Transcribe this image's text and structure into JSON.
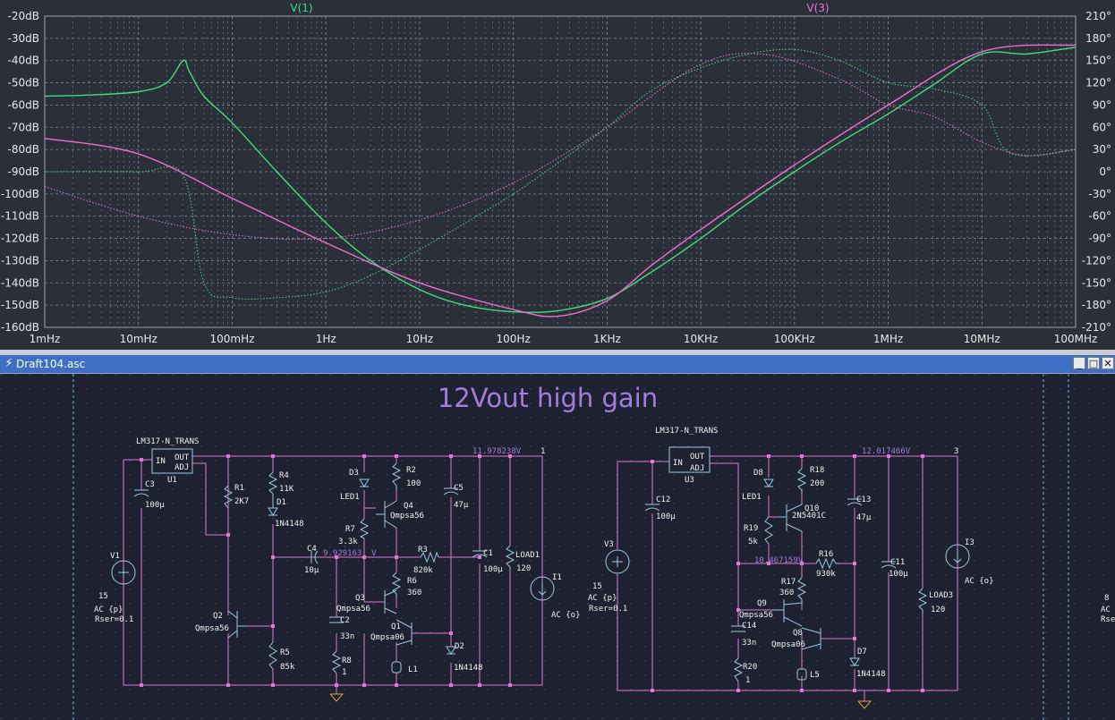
{
  "plot": {
    "trace1_label": "V(1)",
    "trace2_label": "V(3)",
    "colors": {
      "trace1": "#3fe07a",
      "trace2": "#ee6fce",
      "axis_text": "#e8e8e8",
      "grid": "#7d8496",
      "background": "#2b2f3a"
    },
    "y_left_ticks": [
      "-20dB",
      "-30dB",
      "-40dB",
      "-50dB",
      "-60dB",
      "-70dB",
      "-80dB",
      "-90dB",
      "-100dB",
      "-110dB",
      "-120dB",
      "-130dB",
      "-140dB",
      "-150dB",
      "-160dB"
    ],
    "y_right_ticks": [
      "210°",
      "180°",
      "150°",
      "120°",
      "90°",
      "60°",
      "30°",
      "0°",
      "-30°",
      "-60°",
      "-90°",
      "-120°",
      "-150°",
      "-180°",
      "-210°"
    ],
    "x_ticks": [
      "1mHz",
      "10mHz",
      "100mHz",
      "1Hz",
      "10Hz",
      "100Hz",
      "1KHz",
      "10KHz",
      "100KHz",
      "1MHz",
      "10MHz",
      "100MHz"
    ]
  },
  "chart_data": {
    "type": "line",
    "x_scale": "log",
    "xlim": [
      0.001,
      100000000
    ],
    "ylim_left": [
      -160,
      -20
    ],
    "ylim_right": [
      -210,
      210
    ],
    "xlabel": "",
    "ylabel": "",
    "series": [
      {
        "name": "V(1)",
        "axis": "magnitude dB",
        "x": [
          0.001,
          0.003,
          0.01,
          0.02,
          0.03,
          0.035,
          0.05,
          0.1,
          0.3,
          1,
          3,
          10,
          30,
          100,
          300,
          1000,
          3000,
          10000,
          30000,
          100000,
          300000,
          1000000,
          3000000,
          10000000,
          30000000,
          100000000
        ],
        "y": [
          -56,
          -55.5,
          -54,
          -50,
          -40,
          -45,
          -56,
          -68,
          -90,
          -113,
          -130,
          -143,
          -150,
          -153,
          -152.5,
          -147,
          -135,
          -120,
          -105,
          -90,
          -77,
          -64,
          -51,
          -37,
          -37,
          -34
        ]
      },
      {
        "name": "V(1)",
        "axis": "phase deg",
        "x": [
          0.001,
          0.01,
          0.03,
          0.05,
          0.1,
          0.3,
          1,
          3,
          10,
          30,
          100,
          300,
          1000,
          3000,
          10000,
          30000,
          100000,
          300000,
          1000000,
          3000000,
          10000000,
          20000000,
          100000000
        ],
        "y": [
          0,
          0,
          -5,
          -150,
          -170,
          -170,
          -162,
          -140,
          -105,
          -70,
          -30,
          12,
          60,
          110,
          140,
          158,
          165,
          150,
          120,
          112,
          90,
          25,
          30
        ]
      },
      {
        "name": "V(3)",
        "axis": "magnitude dB",
        "x": [
          0.001,
          0.01,
          0.1,
          1,
          10,
          100,
          300,
          1000,
          3000,
          10000,
          100000,
          1000000,
          10000000,
          100000000
        ],
        "y": [
          -75,
          -82,
          -102,
          -122,
          -140,
          -152,
          -155,
          -148,
          -132,
          -116,
          -87,
          -60,
          -36,
          -33
        ]
      },
      {
        "name": "V(3)",
        "axis": "phase deg",
        "x": [
          0.001,
          0.01,
          0.1,
          1,
          10,
          100,
          1000,
          10000,
          50000,
          300000,
          1000000,
          3000000,
          10000000,
          30000000,
          100000000
        ],
        "y": [
          -20,
          -60,
          -85,
          -90,
          -65,
          -15,
          60,
          145,
          158,
          125,
          90,
          75,
          40,
          22,
          30
        ]
      }
    ]
  },
  "window": {
    "title": "Draft104.asc",
    "app_icon": "ltspice-icon",
    "minimize": "_",
    "restore": "□",
    "close": "✕"
  },
  "schematic": {
    "heading": "12Vout high gain",
    "colors": {
      "wire": "#e078d8",
      "component": "#9cc8e0",
      "text": "#f0f0f0",
      "net_label": "#a37ce0",
      "junction": "#e078d8",
      "ground": "#e0a040"
    },
    "left": {
      "ic_name": "LM317-N_TRANS",
      "ic_ref": "U1",
      "ic_in": "IN",
      "ic_out": "OUT",
      "ic_adj": "ADJ",
      "out_voltage": "11.978238V",
      "out_node": "1",
      "mid_voltage": "9.929163  V",
      "V1": "V1",
      "V1_val": "15",
      "V1_ac": "AC {p}",
      "V1_rser": "Rser=0.1",
      "C3": "C3",
      "C3_val": "100µ",
      "R1": "R1",
      "R1_val": "2K7",
      "R4": "R4",
      "R4_val": "11K",
      "D1": "D1",
      "D1_val": "1N4148",
      "D3": "D3",
      "D3_val": "LED1",
      "R2": "R2",
      "R2_val": "100",
      "Q4": "Q4",
      "Q4_val": "Qmpsa56",
      "C5": "C5",
      "C5_val": "47µ",
      "R7": "R7",
      "R7_val": "3.3k",
      "C4": "C4",
      "C4_val": "10µ",
      "R3": "R3",
      "R3_val": "820k",
      "R6": "R6",
      "R6_val": "360",
      "C1": "C1",
      "C1_val": "100µ",
      "LOAD1": "LOAD1",
      "LOAD1_val": "120",
      "I1": "I1",
      "I1_val": "AC {o}",
      "Q2": "Q2",
      "Q2_val": "Qmpsa56",
      "Q3": "Q3",
      "Q3_val": "Qmpsa56",
      "C2": "C2",
      "C2_val": "33n",
      "Q1": "Q1",
      "Q1_val": "Qmpsa06",
      "D2": "D2",
      "D2_val": "1N4148",
      "R5": "R5",
      "R5_val": "85k",
      "R8": "R8",
      "R8_val": "1",
      "L1": "L1"
    },
    "right": {
      "ic_name": "LM317-N_TRANS",
      "ic_ref": "U3",
      "ic_in": "IN",
      "ic_out": "OUT",
      "ic_adj": "ADJ",
      "out_voltage": "12.017466V",
      "out_node": "3",
      "mid_voltage": "10.467159V",
      "V3": "V3",
      "V3_val": "15",
      "V3_ac": "AC {p}",
      "V3_rser": "Rser=0.1",
      "C12": "C12",
      "C12_val": "100µ",
      "D8": "D8",
      "D8_val": "LED1",
      "R18": "R18",
      "R18_val": "200",
      "Q10": "Q10",
      "Q10_val": "2N5401C",
      "C13": "C13",
      "C13_val": "47µ",
      "R19": "R19",
      "R19_val": "5k",
      "R16": "R16",
      "R16_val": "930k",
      "C11": "C11",
      "C11_val": "100µ",
      "I3": "I3",
      "I3_val": "AC {o}",
      "R17": "R17",
      "R17_val": "360",
      "LOAD3": "LOAD3",
      "LOAD3_val": "120",
      "Q9": "Q9",
      "Q9_val": "Qmpsa56",
      "C14": "C14",
      "C14_val": "33n",
      "Q8": "Q8",
      "Q8_val": "Qmpsa06",
      "D7": "D7",
      "D7_val": "1N4148",
      "R20": "R20",
      "R20_val": "1",
      "L5": "L5"
    },
    "partial_right": {
      "val": "8",
      "ac": "AC {",
      "rser": "Rse"
    }
  }
}
